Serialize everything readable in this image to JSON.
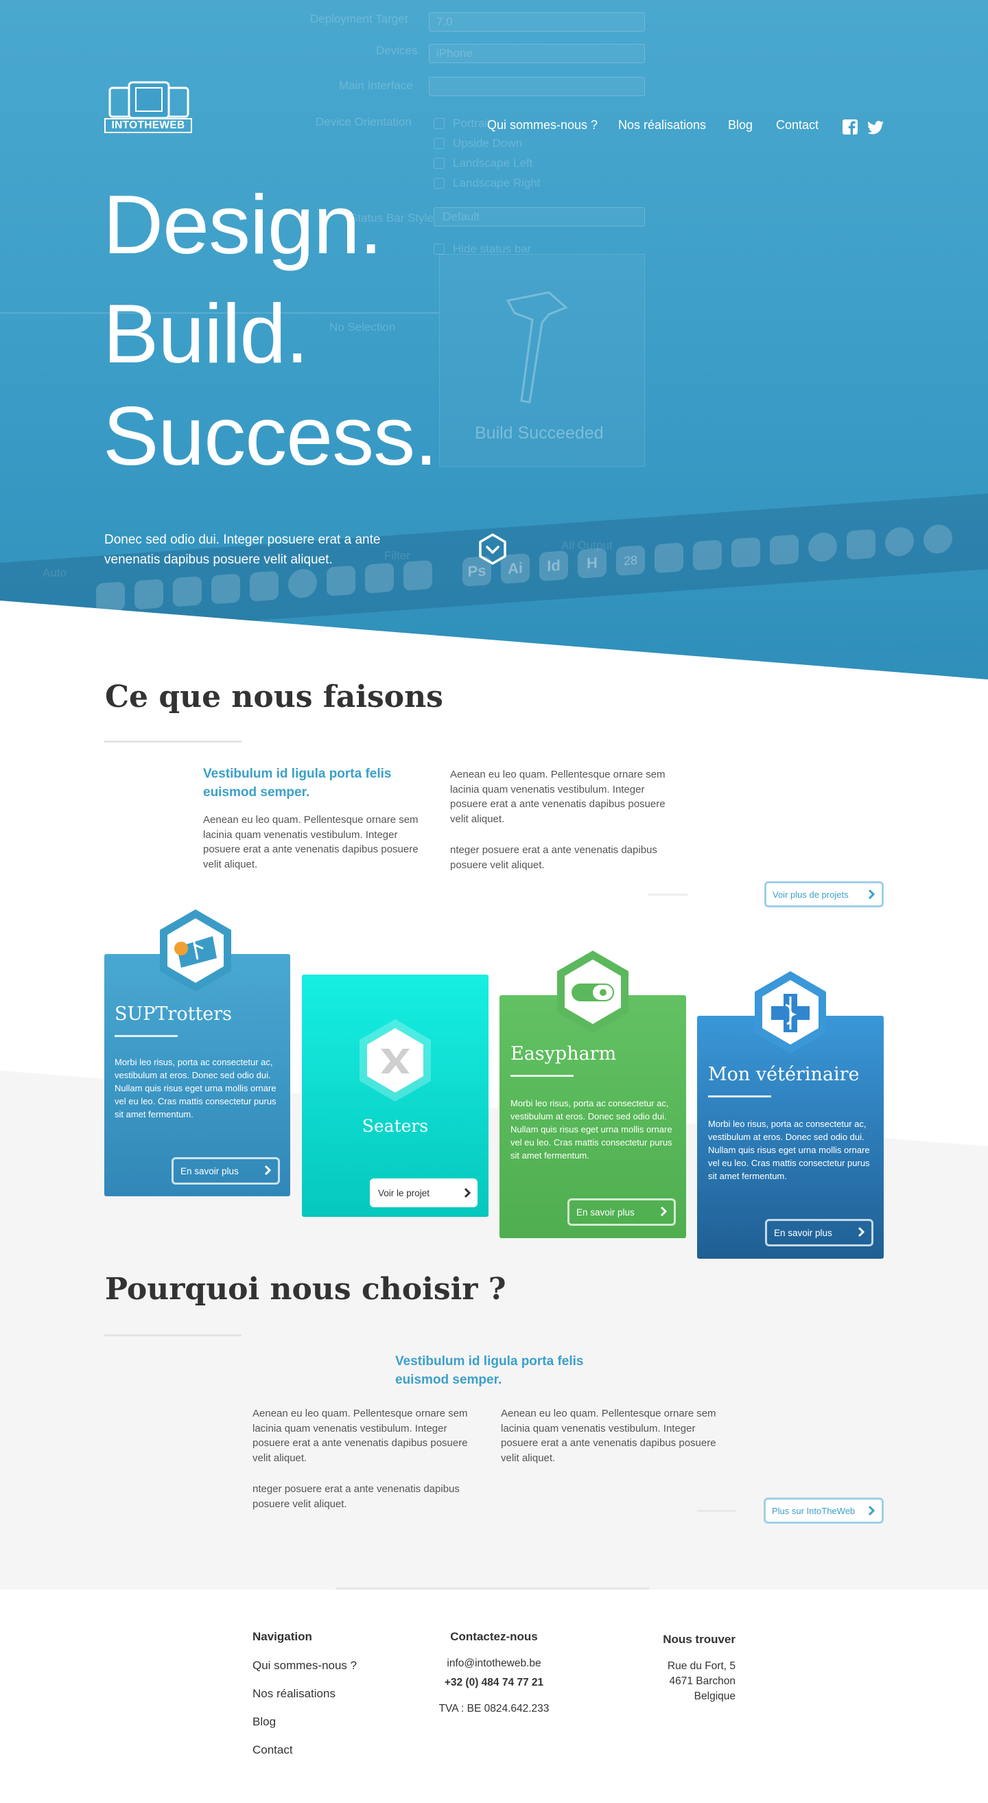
{
  "brand": {
    "logo_text": "INTOTHEWEB"
  },
  "nav": {
    "items": [
      "Qui sommes-nous ?",
      "Nos réalisations",
      "Blog",
      "Contact"
    ],
    "social": [
      "facebook-icon",
      "twitter-icon"
    ]
  },
  "hero": {
    "title_lines": [
      "Design.",
      "Build.",
      "Success."
    ],
    "subtitle": "Donec sed odio dui. Integer posuere erat a ante venenatis dapibus posuere velit aliquet.",
    "background_ui": {
      "labels": [
        "Deployment Target",
        "Devices",
        "Main Interface",
        "Device Orientation",
        "Status Bar Style",
        "No Selection",
        "Auto",
        "All Output",
        "Filter",
        "Build Succeeded"
      ],
      "values": [
        "7.0",
        "iPhone",
        "Portrait",
        "Upside Down",
        "Landscape Left",
        "Landscape Right",
        "Default",
        "Hide status bar"
      ],
      "dock_labels": [
        "Ps",
        "Ai",
        "Id",
        "H",
        "28"
      ]
    }
  },
  "services": {
    "title": "Ce que nous faisons",
    "lead": "Vestibulum id ligula porta felis euismod semper.",
    "col1": "Aenean eu leo quam. Pellentesque ornare sem lacinia quam venenatis vestibulum. Integer posuere erat a ante venenatis dapibus posuere velit aliquet.",
    "col2a": "Aenean eu leo quam. Pellentesque ornare sem lacinia quam venenatis vestibulum. Integer posuere erat a ante venenatis dapibus posuere velit aliquet.",
    "col2b": "nteger posuere erat a ante venenatis dapibus posuere velit aliquet.",
    "more_button": "Voir plus de projets"
  },
  "projects": [
    {
      "title": "SUPTrotters",
      "text": "Morbi leo risus, porta ac consectetur ac, vestibulum at eros. Donec sed odio dui. Nullam quis risus eget urna mollis ornare vel eu leo. Cras mattis consectetur purus sit amet fermentum.",
      "button": "En savoir plus",
      "color": "#3a9cc6"
    },
    {
      "title": "Seaters",
      "button": "Voir le projet",
      "color": "#14d9d0"
    },
    {
      "title": "Easypharm",
      "text": "Morbi leo risus, porta ac consectetur ac, vestibulum at eros. Donec sed odio dui. Nullam quis risus eget urna mollis ornare vel eu leo. Cras mattis consectetur purus sit amet fermentum.",
      "button": "En savoir plus",
      "color": "#5cb85c"
    },
    {
      "title": "Mon vétérinaire",
      "text": "Morbi leo risus, porta ac consectetur ac, vestibulum at eros. Donec sed odio dui. Nullam quis risus eget urna mollis ornare vel eu leo. Cras mattis consectetur purus sit amet fermentum.",
      "button": "En savoir plus",
      "color": "#2f86cf"
    }
  ],
  "why": {
    "title": "Pourquoi nous choisir ?",
    "lead": "Vestibulum id ligula porta felis euismod semper.",
    "col1a": "Aenean eu leo quam. Pellentesque ornare sem lacinia quam venenatis vestibulum. Integer posuere erat a ante venenatis dapibus posuere velit aliquet.",
    "col1b": "nteger posuere erat a ante venenatis dapibus posuere velit aliquet.",
    "col2": "Aenean eu leo quam. Pellentesque ornare sem lacinia quam venenatis vestibulum. Integer posuere erat a ante venenatis dapibus posuere velit aliquet.",
    "more_button": "Plus sur IntoTheWeb"
  },
  "footer": {
    "nav_title": "Navigation",
    "nav_items": [
      "Qui sommes-nous ?",
      "Nos réalisations",
      "Blog",
      "Contact"
    ],
    "contact_title": "Contactez-nous",
    "email": "info@intotheweb.be",
    "phone": "+32 (0) 484 74 77 21",
    "vat": "TVA : BE 0824.642.233",
    "find_title": "Nous trouver",
    "address": [
      "Rue du Fort, 5",
      "4671 Barchon",
      "Belgique"
    ]
  }
}
